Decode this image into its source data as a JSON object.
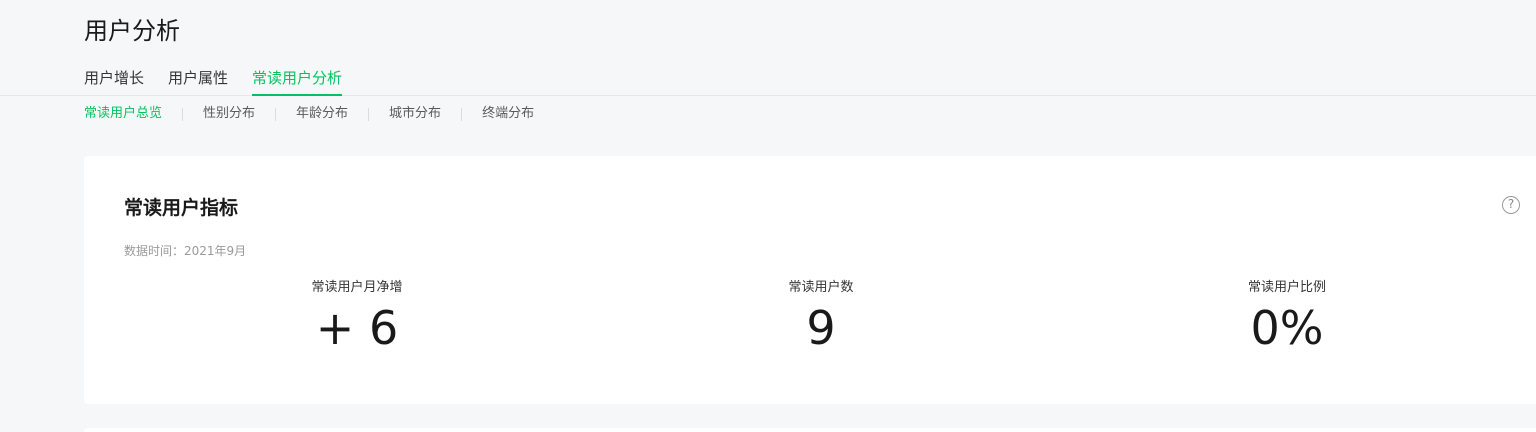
{
  "page": {
    "title": "用户分析"
  },
  "main_tabs": [
    {
      "label": "用户增长",
      "active": false
    },
    {
      "label": "用户属性",
      "active": false
    },
    {
      "label": "常读用户分析",
      "active": true
    }
  ],
  "sub_tabs": [
    {
      "label": "常读用户总览",
      "active": true
    },
    {
      "label": "性别分布",
      "active": false
    },
    {
      "label": "年龄分布",
      "active": false
    },
    {
      "label": "城市分布",
      "active": false
    },
    {
      "label": "终端分布",
      "active": false
    }
  ],
  "card": {
    "title": "常读用户指标",
    "help_icon": "question-circle-icon",
    "data_time": "数据时间：2021年9月",
    "metrics": [
      {
        "label": "常读用户月净增",
        "value": "+ 6"
      },
      {
        "label": "常读用户数",
        "value": "9"
      },
      {
        "label": "常读用户比例",
        "value": "0%"
      }
    ]
  },
  "colors": {
    "accent": "#07c160",
    "background": "#f6f7f9",
    "card": "#ffffff"
  }
}
